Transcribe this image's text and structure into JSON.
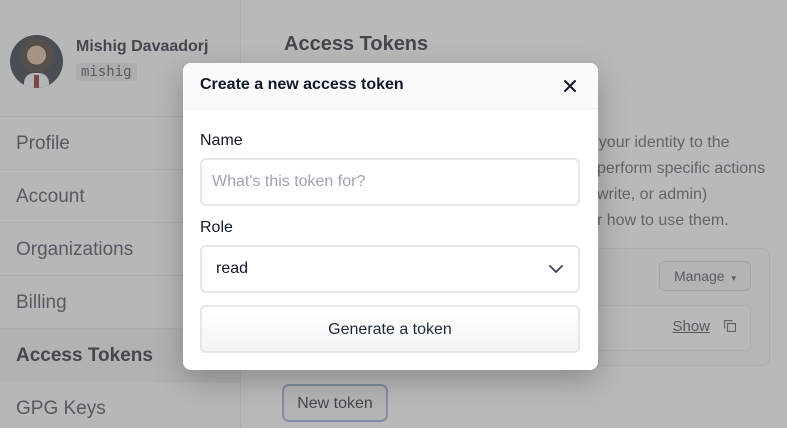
{
  "user": {
    "name": "Mishig Davaadorj",
    "handle": "mishig"
  },
  "sidebar": {
    "items": [
      {
        "label": "Profile"
      },
      {
        "label": "Account"
      },
      {
        "label": "Organizations"
      },
      {
        "label": "Billing"
      },
      {
        "label": "Access Tokens",
        "active": true
      },
      {
        "label": "GPG Keys"
      }
    ]
  },
  "main": {
    "title": "Access Tokens",
    "description_lines": [
      "te your identity to the",
      "perform specific actions",
      " write, or admin)",
      "r how to use them."
    ],
    "manage_label": "Manage",
    "show_label": "Show",
    "new_token_label": "New token"
  },
  "modal": {
    "title": "Create a new access token",
    "name_label": "Name",
    "name_placeholder": "What's this token for?",
    "name_value": "",
    "role_label": "Role",
    "role_value": "read",
    "generate_label": "Generate a token"
  },
  "icons": {
    "close": "close-icon",
    "chevron": "chevron-down-icon",
    "caret": "caret-down-icon",
    "copy": "copy-icon"
  },
  "colors": {
    "overlay": "#737373",
    "focus_border": "#93a5cf"
  }
}
